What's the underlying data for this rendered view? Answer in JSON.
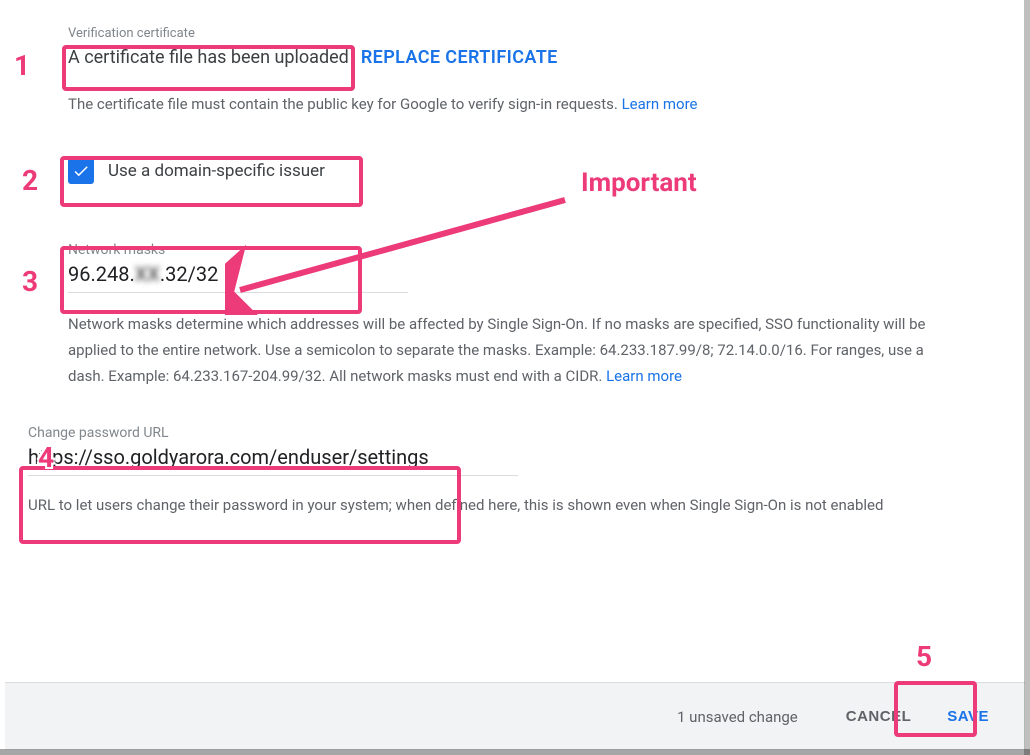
{
  "certificate": {
    "section_label": "Verification certificate",
    "status": "A certificate file has been uploaded",
    "replace_label": "REPLACE CERTIFICATE",
    "helper": "The certificate file must contain the public key for Google to verify sign-in requests. ",
    "learn_more": "Learn more"
  },
  "checkbox": {
    "checked": true,
    "label": "Use a domain-specific issuer"
  },
  "network_masks": {
    "label": "Network masks",
    "value_prefix": "96.248.",
    "value_obscured": "XX",
    "value_suffix": ".32/32",
    "description": "Network masks determine which addresses will be affected by Single Sign-On. If no masks are specified, SSO functionality will be applied to the entire network. Use a semicolon to separate the masks. Example: 64.233.187.99/8; 72.14.0.0/16. For ranges, use a dash. Example: 64.233.167-204.99/32. All network masks must end with a CIDR. ",
    "learn_more": "Learn more"
  },
  "change_password": {
    "label": "Change password URL",
    "value": "https://sso.goldyarora.com/enduser/settings",
    "description": "URL to let users change their password in your system; when defined here, this is shown even when Single Sign-On is not enabled"
  },
  "footer": {
    "unsaved": "1 unsaved change",
    "cancel": "CANCEL",
    "save": "SAVE"
  },
  "annotations": {
    "n1": "1",
    "n2": "2",
    "n3": "3",
    "n4": "4",
    "n5": "5",
    "important": "Important",
    "color": "#ed3a78"
  }
}
